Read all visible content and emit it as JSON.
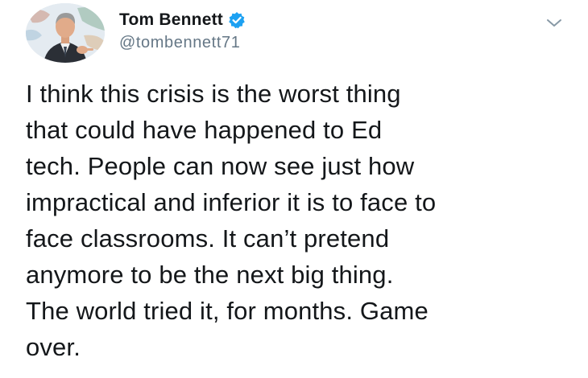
{
  "tweet": {
    "author": {
      "display_name": "Tom Bennett",
      "handle": "@tombennett71",
      "verified": true,
      "verified_color": "#1da1f2"
    },
    "menu_icon": "chevron-down-icon",
    "text_lines": [
      "I think this crisis is the worst thing",
      "that could have happened to Ed",
      "tech. People can now see just how",
      "impractical and inferior it is to face to",
      "face classrooms. It can’t pretend",
      "anymore to be the next big thing.",
      "The world tried it, for months. Game",
      "over."
    ]
  }
}
